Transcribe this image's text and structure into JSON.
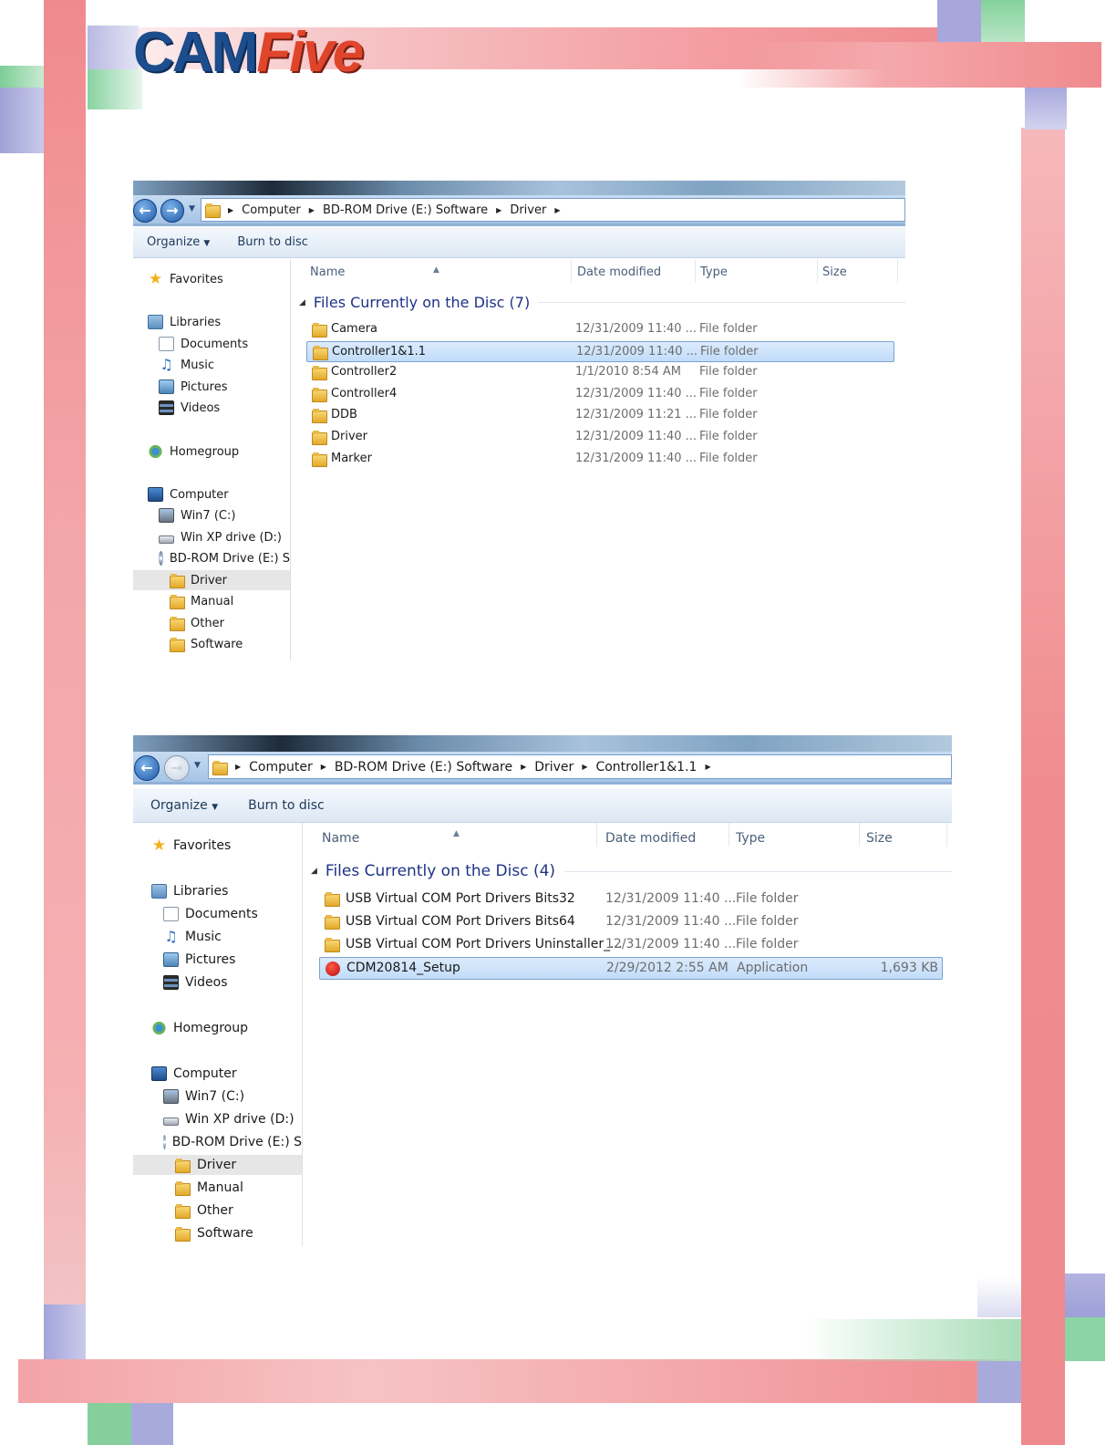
{
  "logo": {
    "part1": "CAM",
    "part2": "Five"
  },
  "window1": {
    "breadcrumb": [
      "Computer",
      "BD-ROM Drive (E:) Software",
      "Driver"
    ],
    "toolbar": {
      "organize": "Organize",
      "burn": "Burn to disc"
    },
    "columns": {
      "name": "Name",
      "date": "Date modified",
      "type": "Type",
      "size": "Size"
    },
    "group_title": "Files Currently on the Disc (7)",
    "nav": {
      "favorites": "Favorites",
      "libraries": "Libraries",
      "documents": "Documents",
      "music": "Music",
      "pictures": "Pictures",
      "videos": "Videos",
      "homegroup": "Homegroup",
      "computer": "Computer",
      "win7": "Win7 (C:)",
      "winxp": "Win XP drive (D:)",
      "bdrom": "BD-ROM Drive (E:) S",
      "driver": "Driver",
      "manual": "Manual",
      "other": "Other",
      "software": "Software"
    },
    "files": [
      {
        "name": "Camera",
        "date": "12/31/2009 11:40 ...",
        "type": "File folder",
        "size": ""
      },
      {
        "name": "Controller1&1.1",
        "date": "12/31/2009 11:40 ...",
        "type": "File folder",
        "size": ""
      },
      {
        "name": "Controller2",
        "date": "1/1/2010 8:54 AM",
        "type": "File folder",
        "size": ""
      },
      {
        "name": "Controller4",
        "date": "12/31/2009 11:40 ...",
        "type": "File folder",
        "size": ""
      },
      {
        "name": "DDB",
        "date": "12/31/2009 11:21 ...",
        "type": "File folder",
        "size": ""
      },
      {
        "name": "Driver",
        "date": "12/31/2009 11:40 ...",
        "type": "File folder",
        "size": ""
      },
      {
        "name": "Marker",
        "date": "12/31/2009 11:40 ...",
        "type": "File folder",
        "size": ""
      }
    ]
  },
  "window2": {
    "breadcrumb": [
      "Computer",
      "BD-ROM Drive (E:) Software",
      "Driver",
      "Controller1&1.1"
    ],
    "toolbar": {
      "organize": "Organize",
      "burn": "Burn to disc"
    },
    "columns": {
      "name": "Name",
      "date": "Date modified",
      "type": "Type",
      "size": "Size"
    },
    "group_title": "Files Currently on the Disc (4)",
    "nav": {
      "favorites": "Favorites",
      "libraries": "Libraries",
      "documents": "Documents",
      "music": "Music",
      "pictures": "Pictures",
      "videos": "Videos",
      "homegroup": "Homegroup",
      "computer": "Computer",
      "win7": "Win7 (C:)",
      "winxp": "Win XP drive (D:)",
      "bdrom": "BD-ROM Drive (E:) S",
      "driver": "Driver",
      "manual": "Manual",
      "other": "Other",
      "software": "Software"
    },
    "files": [
      {
        "name": "USB Virtual COM Port Drivers Bits32",
        "date": "12/31/2009 11:40 ...",
        "type": "File folder",
        "size": ""
      },
      {
        "name": "USB Virtual COM Port Drivers Bits64",
        "date": "12/31/2009 11:40 ...",
        "type": "File folder",
        "size": ""
      },
      {
        "name": "USB Virtual COM Port Drivers Uninstaller_...",
        "date": "12/31/2009 11:40 ...",
        "type": "File folder",
        "size": ""
      },
      {
        "name": "CDM20814_Setup",
        "date": "2/29/2012 2:55 AM",
        "type": "Application",
        "size": "1,693 KB"
      }
    ]
  },
  "colors": {
    "brand_blue": "#1c4d8c",
    "brand_red": "#e0452b",
    "selection": "#c1dcfa"
  }
}
